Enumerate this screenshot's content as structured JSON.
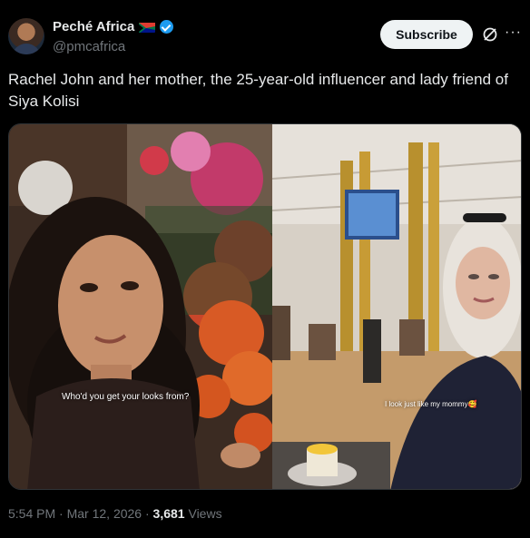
{
  "author": {
    "name": "Peché Africa",
    "handle": "@pmcafrica",
    "verified": true,
    "flag": "south-africa-flag-icon"
  },
  "actions": {
    "subscribe_label": "Subscribe"
  },
  "post": {
    "text": "Rachel John and her mother, the 25-year-old influencer and lady friend of Siya Kolisi",
    "media": {
      "left_caption": "Who'd you get your looks from?",
      "right_caption": "I look just like my mommy🥰"
    }
  },
  "meta": {
    "time": "5:54 PM",
    "sep1": "·",
    "date": "Mar 12, 2026",
    "sep2": "·",
    "views_count": "3,681",
    "views_label": "Views"
  },
  "colors": {
    "background": "#000000",
    "text": "#e7e9ea",
    "secondary_text": "#71767b",
    "verified_badge": "#1d9bf0",
    "subscribe_bg": "#eff3f4"
  }
}
